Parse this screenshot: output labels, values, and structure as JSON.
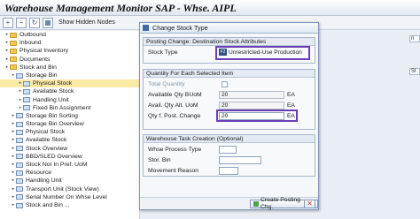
{
  "window": {
    "title": "Warehouse Management Monitor SAP - Whse. AIPL"
  },
  "toolbar": {
    "show_hidden_nodes_label": "Show Hidden Nodes"
  },
  "tree": {
    "items": [
      {
        "label": "Outbound",
        "indent": 1
      },
      {
        "label": "Inbound",
        "indent": 1
      },
      {
        "label": "Physical Inventory",
        "indent": 1
      },
      {
        "label": "Documents",
        "indent": 1
      },
      {
        "label": "Stock and Bin",
        "indent": 1
      },
      {
        "label": "Storage Bin",
        "indent": 2
      },
      {
        "label": "Physical Stock",
        "indent": 3
      },
      {
        "label": "Available Stock",
        "indent": 3
      },
      {
        "label": "Handling Unit",
        "indent": 3
      },
      {
        "label": "Fixed Bin Assignment",
        "indent": 3
      },
      {
        "label": "Storage Bin Sorting",
        "indent": 2
      },
      {
        "label": "Storage Bin Overview",
        "indent": 2
      },
      {
        "label": "Physical Stock",
        "indent": 2
      },
      {
        "label": "Available Stock",
        "indent": 2
      },
      {
        "label": "Stock Overview",
        "indent": 2
      },
      {
        "label": "BBD/SLED Overview",
        "indent": 2
      },
      {
        "label": "Stock Not In Pref. UoM",
        "indent": 2
      },
      {
        "label": "Resource",
        "indent": 2
      },
      {
        "label": "Handling Unit",
        "indent": 2
      },
      {
        "label": "Transport Unit (Stock View)",
        "indent": 2
      },
      {
        "label": "Serial Number On Whse Level",
        "indent": 2
      },
      {
        "label": "Stock and Bin ...",
        "indent": 2
      }
    ]
  },
  "right_pane": {
    "cells": [
      "n",
      "SI"
    ]
  },
  "dialog": {
    "title": "Change Stock Type",
    "posting_group": {
      "title": "Posting Change: Destination Stock Attributes",
      "stock_type_label": "Stock Type",
      "stock_type_key": "F2",
      "stock_type_text": "Unrestricted-Use Production"
    },
    "qty_group": {
      "title": "Quantity For Each Selected Item",
      "total_label": "Total Quantity",
      "avail_buom_label": "Available Qty BUoM",
      "avail_buom_value": "20",
      "avail_buom_unit": "EA",
      "avail_alt_label": "Avail. Qty Alt. UoM",
      "avail_alt_value": "20",
      "avail_alt_unit": "EA",
      "post_change_label": "Qty f. Post. Change",
      "post_change_value": "20",
      "post_change_unit": "EA"
    },
    "task_group": {
      "title": "Warehouse Task Creation (Optional)",
      "process_type_label": "Whse Process Type",
      "stor_bin_label": "Stor. Bin",
      "movement_reason_label": "Movement Reason"
    },
    "buttons": {
      "create_label": "Create Posting Chg."
    }
  },
  "colors": {
    "highlight": "#6a3fb5",
    "selected_row": "#fbe9a6",
    "folder": "#f3c64e"
  }
}
